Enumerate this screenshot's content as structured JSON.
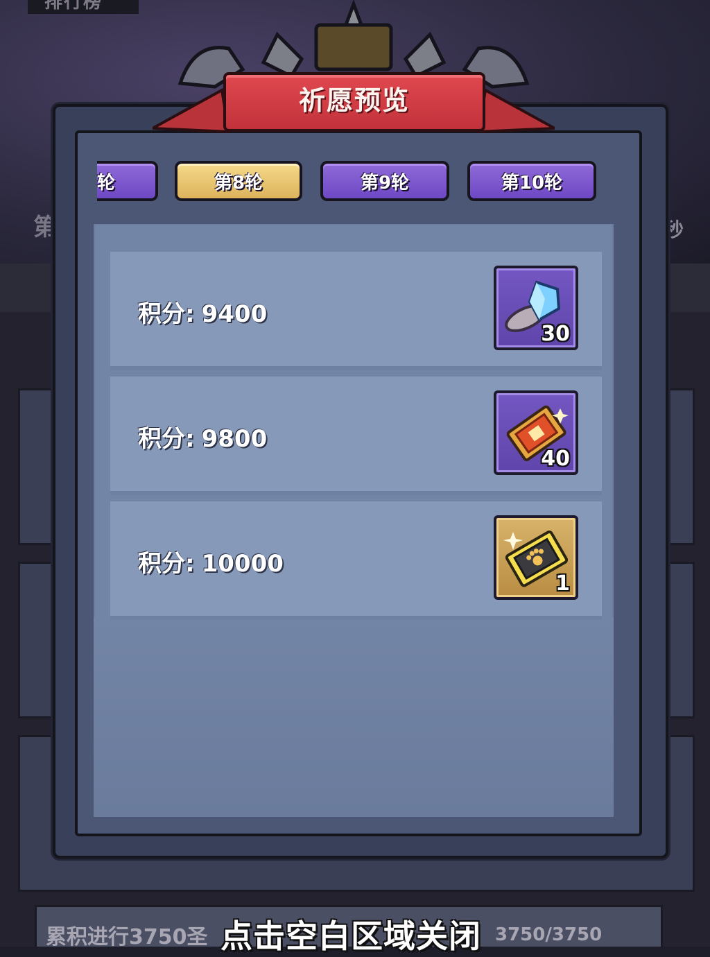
{
  "background": {
    "corner_title": "排行榜",
    "left_label": "第",
    "right_label": "秒",
    "bottom_left_text": "累积进行3750圣",
    "bottom_right_text": "3750/3750"
  },
  "modal": {
    "title": "祈愿预览",
    "tabs": [
      {
        "label": "轮",
        "state": "partial"
      },
      {
        "label": "第8轮",
        "state": "selected"
      },
      {
        "label": "第9轮",
        "state": "normal"
      },
      {
        "label": "第10轮",
        "state": "normal"
      }
    ],
    "rewards": [
      {
        "label": "积分:",
        "value": "9400",
        "item": "blue-crystal-icon",
        "count": "30"
      },
      {
        "label": "积分:",
        "value": "9800",
        "item": "red-ticket-icon",
        "count": "40"
      },
      {
        "label": "积分:",
        "value": "10000",
        "item": "paw-ticket-icon",
        "count": "1"
      }
    ]
  },
  "close_hint": "点击空白区域关闭",
  "colors": {
    "tab_selected": "#f5d98a",
    "tab_normal": "#8f6ad8",
    "banner": "#e0484f"
  }
}
